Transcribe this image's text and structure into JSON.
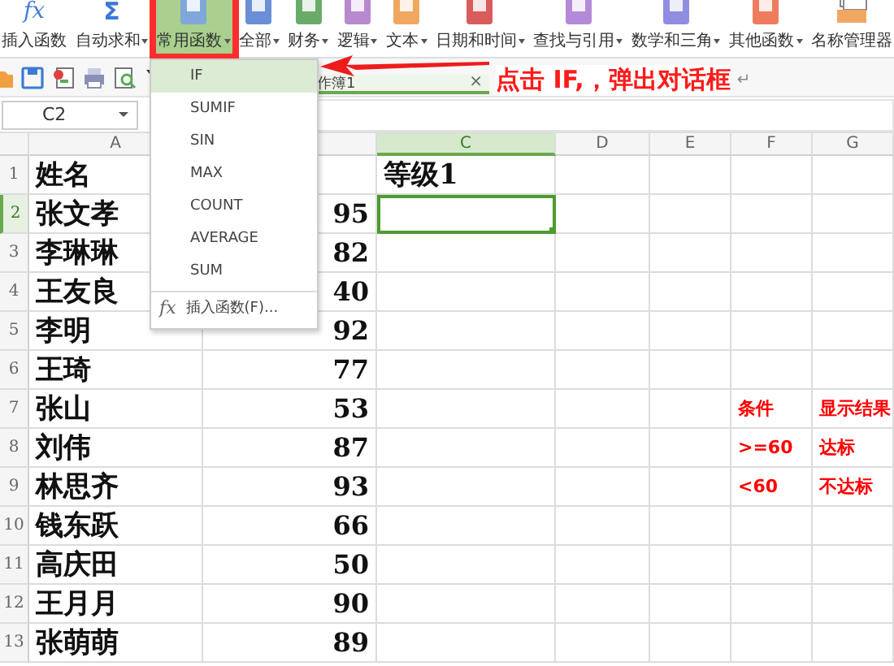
{
  "ribbon": {
    "items": [
      {
        "kind": "glyph",
        "glyph": "fx",
        "label": "插入函数",
        "dropdown": false,
        "selected": false,
        "outlined": false
      },
      {
        "kind": "glyph",
        "glyph": "Σ",
        "label": "自动求和",
        "dropdown": true,
        "selected": false,
        "outlined": false
      },
      {
        "kind": "book",
        "color": "#7fa7d9",
        "label": "常用函数",
        "dropdown": true,
        "selected": true,
        "outlined": true
      },
      {
        "kind": "book",
        "color": "#6b8fd6",
        "label": "全部",
        "dropdown": true,
        "selected": false,
        "outlined": false
      },
      {
        "kind": "book",
        "color": "#6aab6a",
        "label": "财务",
        "dropdown": true,
        "selected": false,
        "outlined": false
      },
      {
        "kind": "book",
        "color": "#b889cf",
        "label": "逻辑",
        "dropdown": true,
        "selected": false,
        "outlined": false
      },
      {
        "kind": "book",
        "color": "#f0a860",
        "label": "文本",
        "dropdown": true,
        "selected": false,
        "outlined": false
      },
      {
        "kind": "book",
        "color": "#d95c5c",
        "label": "日期和时间",
        "dropdown": true,
        "selected": false,
        "outlined": false
      },
      {
        "kind": "book",
        "color": "#b48ad8",
        "label": "查找与引用",
        "dropdown": true,
        "selected": false,
        "outlined": false
      },
      {
        "kind": "book",
        "color": "#8f8ee0",
        "label": "数学和三角",
        "dropdown": true,
        "selected": false,
        "outlined": false
      },
      {
        "kind": "book",
        "color": "#ee7d5d",
        "label": "其他函数",
        "dropdown": true,
        "selected": false,
        "outlined": false
      },
      {
        "kind": "manager",
        "label": "名称管理器",
        "dropdown": false,
        "selected": false,
        "outlined": false
      }
    ]
  },
  "tab": {
    "label": "作簿1",
    "close": "×"
  },
  "name_box": {
    "value": "C2"
  },
  "menu": {
    "items": [
      {
        "label": "IF",
        "selected": true
      },
      {
        "label": "SUMIF",
        "selected": false
      },
      {
        "label": "SIN",
        "selected": false
      },
      {
        "label": "MAX",
        "selected": false
      },
      {
        "label": "COUNT",
        "selected": false
      },
      {
        "label": "AVERAGE",
        "selected": false
      },
      {
        "label": "SUM",
        "selected": false
      }
    ],
    "footer": {
      "icon_text": "fx",
      "label": "插入函数(F)..."
    }
  },
  "annotation": {
    "text": "点击 IF,，弹出对话框",
    "return_mark": "↵"
  },
  "sheet": {
    "columns": [
      {
        "label": "A",
        "selected": false
      },
      {
        "selected": false
      },
      {
        "label": "C",
        "selected": true
      },
      {
        "label": "D",
        "selected": false
      },
      {
        "label": "E",
        "selected": false
      },
      {
        "label": "F",
        "selected": false
      },
      {
        "label": "G",
        "selected": false
      }
    ],
    "rows": [
      {
        "number": "1",
        "selected": false,
        "cells": {
          "A": {
            "text": "姓名"
          },
          "C": {
            "text": "等级1"
          }
        }
      },
      {
        "number": "2",
        "selected": true,
        "cells": {
          "A": {
            "text": "张文孝"
          },
          "B": {
            "text": "95"
          }
        }
      },
      {
        "number": "3",
        "selected": false,
        "cells": {
          "A": {
            "text": "李琳琳"
          },
          "B": {
            "text": "82"
          }
        }
      },
      {
        "number": "4",
        "selected": false,
        "cells": {
          "A": {
            "text": "王友良"
          },
          "B": {
            "text": "40"
          }
        }
      },
      {
        "number": "5",
        "selected": false,
        "cells": {
          "A": {
            "text": "李明"
          },
          "B": {
            "text": "92"
          }
        }
      },
      {
        "number": "6",
        "selected": false,
        "cells": {
          "A": {
            "text": "王琦"
          },
          "B": {
            "text": "77"
          }
        }
      },
      {
        "number": "7",
        "selected": false,
        "cells": {
          "A": {
            "text": "张山"
          },
          "B": {
            "text": "53"
          },
          "F": {
            "text": "条件",
            "color": "#ff0000"
          },
          "G": {
            "text": "显示结果",
            "color": "#ff0000"
          }
        }
      },
      {
        "number": "8",
        "selected": false,
        "cells": {
          "A": {
            "text": "刘伟"
          },
          "B": {
            "text": "87"
          },
          "F": {
            "text": ">=60",
            "color": "#ff0000"
          },
          "G": {
            "text": "达标",
            "color": "#ff0000"
          }
        }
      },
      {
        "number": "9",
        "selected": false,
        "cells": {
          "A": {
            "text": "林思齐"
          },
          "B": {
            "text": "93"
          },
          "F": {
            "text": "<60",
            "color": "#ff0000"
          },
          "G": {
            "text": "不达标",
            "color": "#ff0000"
          }
        }
      },
      {
        "number": "10",
        "selected": false,
        "cells": {
          "A": {
            "text": "钱东跃"
          },
          "B": {
            "text": "66"
          }
        }
      },
      {
        "number": "11",
        "selected": false,
        "cells": {
          "A": {
            "text": "高庆田"
          },
          "B": {
            "text": "50"
          }
        }
      },
      {
        "number": "12",
        "selected": false,
        "cells": {
          "A": {
            "text": "王月月"
          },
          "B": {
            "text": "90"
          }
        }
      },
      {
        "number": "13",
        "selected": false,
        "cells": {
          "A": {
            "text": "张萌萌"
          },
          "B": {
            "text": "89"
          }
        }
      }
    ]
  }
}
